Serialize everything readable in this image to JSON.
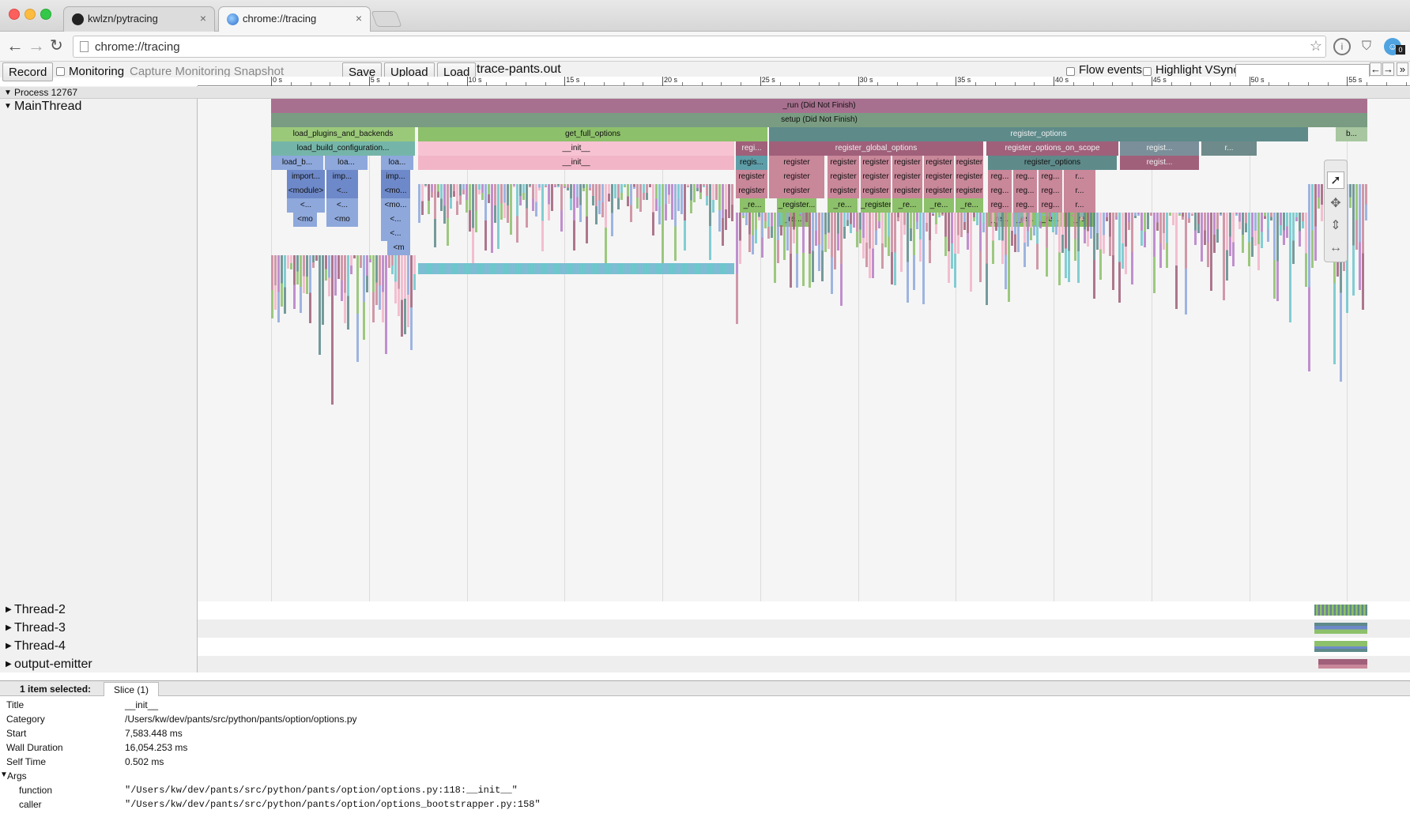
{
  "browser": {
    "tabs": [
      {
        "label": "kwlzn/pytracing",
        "active": false
      },
      {
        "label": "chrome://tracing",
        "active": true
      }
    ],
    "address": "chrome://tracing"
  },
  "toolbar": {
    "record_label": "Record",
    "monitoring_label": "Monitoring",
    "capture_label": "Capture Monitoring Snapshot",
    "save_label": "Save",
    "upload_label": "Upload",
    "load_label": "Load",
    "filename": "trace-pants.out",
    "flow_events_label": "Flow events",
    "highlight_vsync_label": "Highlight VSync",
    "search_value": "",
    "prev_arrow": "←",
    "next_arrow": "→",
    "more": "»"
  },
  "ruler": {
    "labels": [
      "0 s",
      "5 s",
      "10 s",
      "15 s",
      "20 s",
      "25 s",
      "30 s",
      "35 s",
      "40 s",
      "45 s",
      "50 s",
      "55 s"
    ]
  },
  "process": {
    "label": "Process 12767"
  },
  "threads": {
    "main": "MainThread",
    "others": [
      "Thread-2",
      "Thread-3",
      "Thread-4",
      "output-emitter"
    ]
  },
  "slices": {
    "run": "_run (Did Not Finish)",
    "setup": "setup (Did Not Finish)",
    "load_plugins": "load_plugins_and_backends",
    "get_full_options": "get_full_options",
    "register_options": "register_options",
    "b": "b...",
    "load_build_config": "load_build_configuration...",
    "init1": "__init__",
    "regi": "regi...",
    "register_global_options": "register_global_options",
    "register_options_on_scope": "register_options_on_scope",
    "regist1": "regist...",
    "r1": "r...",
    "load_b": "load_b...",
    "loa1": "loa...",
    "loa2": "loa...",
    "init2": "__init__",
    "regis": "regis...",
    "register": "register",
    "register_options2": "register_options",
    "regist2": "regist...",
    "import1": "import...",
    "imp1": "imp...",
    "imp2": "imp...",
    "reg": "reg...",
    "r": "r...",
    "module1": "<module>",
    "lt1": "<...",
    "mo1": "<mo...",
    "re1": "_re...",
    "register2": "_register...",
    "register3": "_register",
    "re2": "_re",
    "mo2": "<mo",
    "mo3": "<mo",
    "lt2": "<...",
    "m": "<m"
  },
  "selection": {
    "count_label": "1 item selected:",
    "tab_label": "Slice (1)",
    "fields": [
      {
        "key": "Title",
        "value": "__init__"
      },
      {
        "key": "Category",
        "value": "/Users/kw/dev/pants/src/python/pants/option/options.py"
      },
      {
        "key": "Start",
        "value": "7,583.448 ms"
      },
      {
        "key": "Wall Duration",
        "value": "16,054.253 ms"
      },
      {
        "key": "Self Time",
        "value": "0.502 ms"
      }
    ],
    "args_label": "Args",
    "args": [
      {
        "key": "function",
        "value": "\"/Users/kw/dev/pants/src/python/pants/option/options.py:118:__init__\""
      },
      {
        "key": "caller",
        "value": "\"/Users/kw/dev/pants/src/python/pants/option/options_bootstrapper.py:158\""
      }
    ]
  },
  "colors": {
    "run": "#a8708f",
    "setup": "#7a9c82",
    "green": "#8dc06a",
    "teal": "#5e8a8a",
    "pink": "#f2b5c8",
    "rose": "#c9879a",
    "blue": "#8ea8dc",
    "mauve": "#a0607a",
    "cyan": "#6ec6cc",
    "purple": "#b67dc6"
  }
}
